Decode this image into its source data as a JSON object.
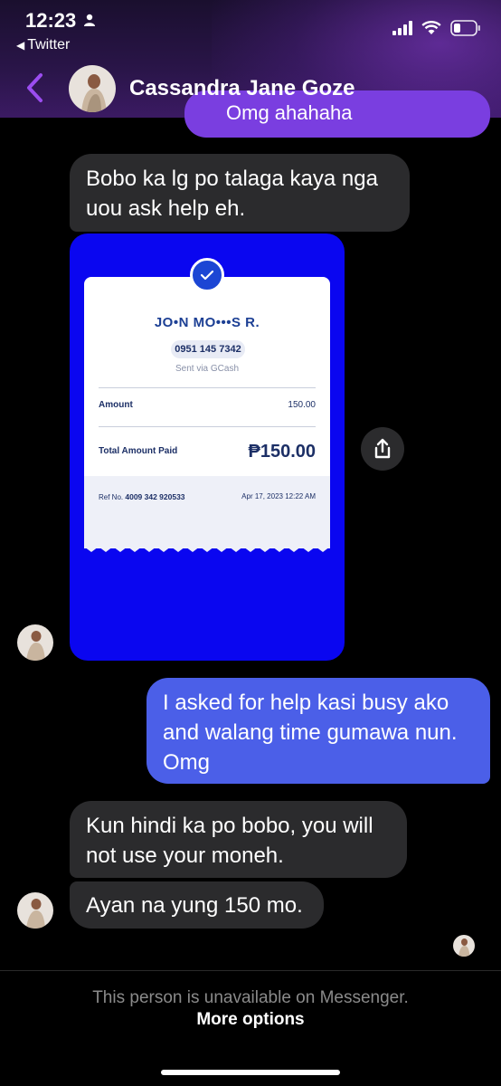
{
  "status_bar": {
    "time": "12:23",
    "back_app_label": "Twitter"
  },
  "header": {
    "contact_name": "Cassandra Jane Goze",
    "accent": "#8b3ee8"
  },
  "messages": {
    "partial_out": "Omg ahahaha",
    "m1": "Bobo ka lg po talaga kaya nga uou ask help eh.",
    "m2": "I asked for help kasi busy ako and walang time gumawa nun. Omg",
    "m3": "Kun hindi ka po bobo, you will not use your moneh.",
    "m4": "Ayan na yung 150 mo."
  },
  "receipt": {
    "recipient": "JO•N MO•••S R.",
    "phone": "0951 145 7342",
    "sent_via": "Sent via GCash",
    "amount_label": "Amount",
    "amount_value": "150.00",
    "total_label": "Total Amount Paid",
    "total_value": "₱150.00",
    "ref_label": "Ref No.",
    "ref_value": "4009 342 920533",
    "date": "Apr 17, 2023 12:22 AM"
  },
  "footer": {
    "unavailable_text": "This person is unavailable on Messenger.",
    "more_options": "More options"
  },
  "colors": {
    "incoming_bubble": "#2b2b2d",
    "outgoing_bubble": "#4b5fe8",
    "receipt_bg": "#0a06f0"
  }
}
